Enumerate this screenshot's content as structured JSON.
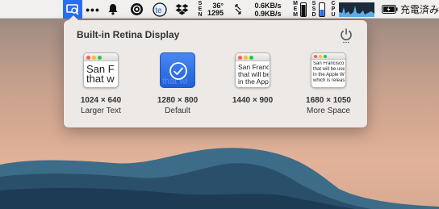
{
  "menubar": {
    "weather": {
      "temp": "36°",
      "value": "1295"
    },
    "network": {
      "up": "0.6KB/s",
      "down": "0.9KB/s"
    },
    "memory_label": "MEM",
    "ssd_label": "SSD",
    "cpu_label": "CPU",
    "battery_text": "充電済み"
  },
  "popover": {
    "title": "Built-in Retina Display",
    "resolutions": [
      {
        "size": "1024 × 640",
        "caption": "Larger Text",
        "preview_text": "San F\nthat w",
        "selected": false
      },
      {
        "size": "1280 × 800",
        "caption": "Default",
        "preview_text": "that wi",
        "selected": true
      },
      {
        "size": "1440 × 900",
        "caption": "",
        "preview_text": "San Francisc\nthat will be\nin the Apple",
        "selected": false
      },
      {
        "size": "1680 × 1050",
        "caption": "More Space",
        "preview_text": "San Francisco is\nthat will be use\nin the Apple Wa\nwhich is release",
        "selected": false
      }
    ]
  },
  "colors": {
    "accent": "#2a6ef0",
    "popover_bg": "#ece9e7",
    "menubar_bg": "#f1f0ef"
  }
}
